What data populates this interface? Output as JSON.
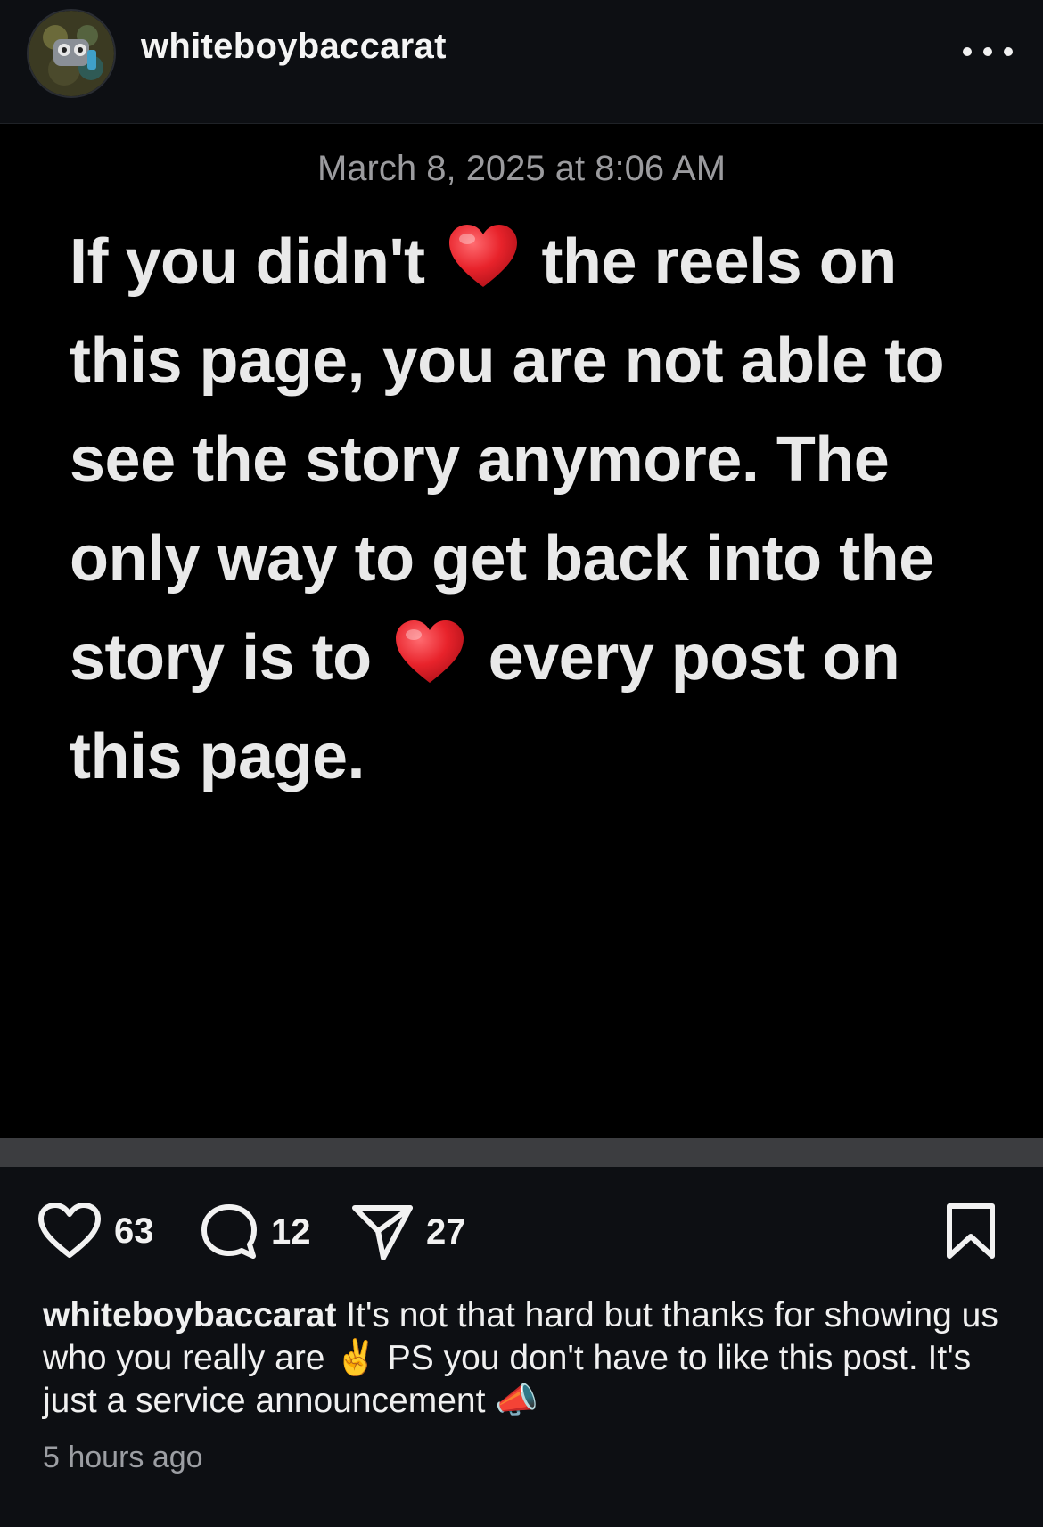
{
  "header": {
    "username": "whiteboybaccarat",
    "more_icon": "ellipsis-icon",
    "avatar_icon": "avatar"
  },
  "media": {
    "timestamp": "March 8, 2025 at 8:06 AM",
    "text_part1": "If you didn't ",
    "text_part2": " the reels on this page, you are not able to see the story anymore. The only way to get back into the story is to ",
    "text_part3": " every post on this page.",
    "emoji": "red-heart-emoji"
  },
  "actions": {
    "likes": "63",
    "comments": "12",
    "shares": "27",
    "like_icon": "heart-icon",
    "comment_icon": "comment-icon",
    "share_icon": "send-icon",
    "save_icon": "bookmark-icon"
  },
  "caption": {
    "username": "whiteboybaccarat",
    "text_part1": " It's not that hard but thanks for showing us who you really are ",
    "text_part2": " PS you don't have to like this post. It's just a service announcement ",
    "emoji1": "✌️",
    "emoji2": "📣"
  },
  "time_ago": "5 hours ago",
  "colors": {
    "background": "#0d0f13",
    "media_background": "#000000",
    "heart_red": "#e8232b",
    "muted_text": "#9c9ea3"
  }
}
